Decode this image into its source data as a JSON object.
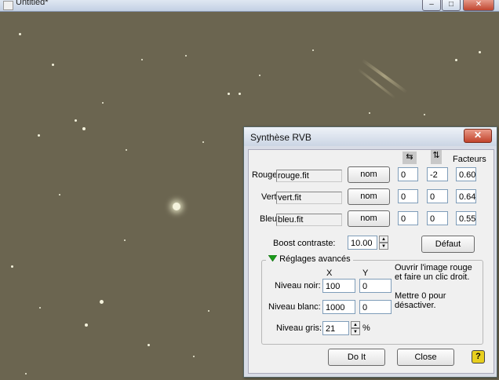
{
  "background_window": {
    "title": "Untitled*",
    "buttons": {
      "minimize": "–",
      "maximize": "□",
      "close": "✕"
    }
  },
  "dialog": {
    "title": "Synthèse RVB",
    "close_symbol": "✕",
    "icons": {
      "mirror_h": "mirror-horizontal-icon",
      "mirror_v": "mirror-vertical-icon",
      "help": "help-icon"
    },
    "factors_header": "Facteurs",
    "channels": [
      {
        "label": "Rouge",
        "file": "rouge.fit",
        "button": "nom",
        "dx": "0",
        "dy": "-2",
        "factor": "0.60"
      },
      {
        "label": "Vert",
        "file": "vert.fit",
        "button": "nom",
        "dx": "0",
        "dy": "0",
        "factor": "0.64"
      },
      {
        "label": "Bleu",
        "file": "bleu.fit",
        "button": "nom",
        "dx": "0",
        "dy": "0",
        "factor": "0.55"
      }
    ],
    "boost": {
      "label": "Boost contraste:",
      "value": "10.00"
    },
    "default_button": "Défaut",
    "advanced": {
      "title": "Réglages avancés",
      "col_x": "X",
      "col_y": "Y",
      "noir_label": "Niveau noir:",
      "noir_x": "100",
      "noir_y": "0",
      "blanc_label": "Niveau blanc:",
      "blanc_x": "1000",
      "blanc_y": "0",
      "gris_label": "Niveau gris:",
      "gris_value": "21",
      "gris_unit": "%",
      "hint1": "Ouvrir l'image rouge et faire un clic droit.",
      "hint2": "Mettre 0 pour désactiver."
    },
    "doit_button": "Do It",
    "close_button": "Close",
    "help_symbol": "?"
  },
  "colors": {
    "sky": "#6b6550",
    "star": "#f4f2dc",
    "dialog_frame": "#d8dce6",
    "accent_green": "#1a9a1a"
  }
}
